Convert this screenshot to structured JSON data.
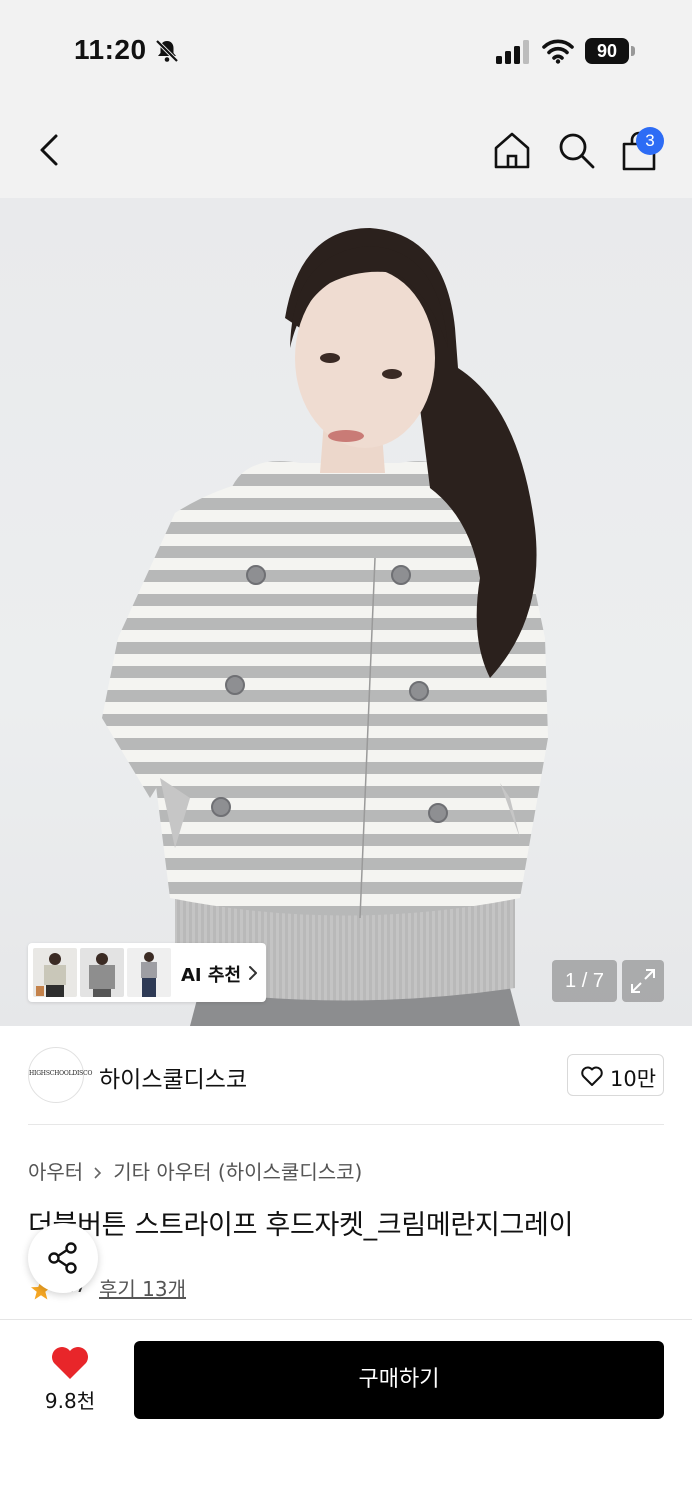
{
  "status_bar": {
    "time": "11:20",
    "battery": "90"
  },
  "nav": {
    "cart_count": "3"
  },
  "gallery": {
    "pager": "1 / 7",
    "ai_recommend_label": "AI 추천"
  },
  "brand": {
    "name": "하이스쿨디스코",
    "logo_text": "HIGHSCHOOLDISCO",
    "likes": "10만"
  },
  "product": {
    "category_main": "아우터",
    "category_sub": "기타 아우터 (하이스쿨디스코)",
    "title": "더블버튼 스트라이프 후드자켓_크림메란지그레이",
    "rating": "..7",
    "reviews": "후기 13개"
  },
  "bottom": {
    "wish_count": "9.8천",
    "buy_label": "구매하기"
  },
  "colors": {
    "accent_blue": "#2d6cf5",
    "heart_red": "#e8262a",
    "star_orange": "#f5a623",
    "buy_black": "#000000"
  }
}
